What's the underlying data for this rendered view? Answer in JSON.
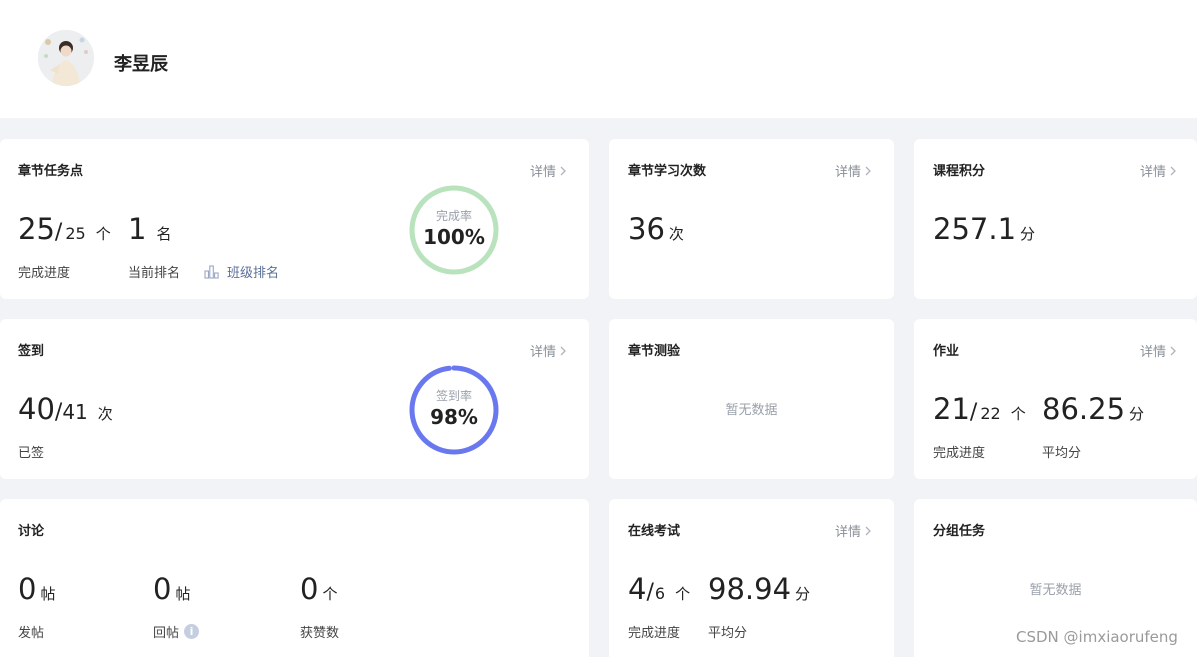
{
  "user": {
    "name": "李昱辰"
  },
  "common": {
    "detail": "详情"
  },
  "chapter_tasks": {
    "title": "章节任务点",
    "done": "25",
    "total": "25",
    "slash": "/",
    "unit": "个",
    "rank": "1",
    "rank_unit": "名",
    "progress_label": "完成进度",
    "rank_label": "当前排名",
    "class_rank_link": "班级排名",
    "ring_label": "完成率",
    "ring_value": "100%",
    "ring_fraction": 1.0,
    "ring_color": "#b8e3bd"
  },
  "chapter_study": {
    "title": "章节学习次数",
    "value": "36",
    "unit": "次"
  },
  "course_points": {
    "title": "课程积分",
    "value": "257.1",
    "unit": "分"
  },
  "signin": {
    "title": "签到",
    "done": "40",
    "total": "41",
    "slash": "/",
    "unit": "次",
    "label": "已签",
    "ring_label": "签到率",
    "ring_value": "98%",
    "ring_fraction": 0.98,
    "ring_color": "#6a78f0",
    "ring_track": "#e3e6f5"
  },
  "chapter_test": {
    "title": "章节测验",
    "empty": "暂无数据"
  },
  "homework": {
    "title": "作业",
    "done": "21",
    "total": "22",
    "slash": "/",
    "unit": "个",
    "avg": "86.25",
    "avg_unit": "分",
    "progress_label": "完成进度",
    "avg_label": "平均分"
  },
  "discussion": {
    "title": "讨论",
    "posts": "0",
    "posts_unit": "帖",
    "posts_label": "发帖",
    "replies": "0",
    "replies_unit": "帖",
    "replies_label": "回帖",
    "likes": "0",
    "likes_unit": "个",
    "likes_label": "获赞数",
    "info_icon": "i"
  },
  "online_exam": {
    "title": "在线考试",
    "done": "4",
    "total": "6",
    "slash": "/",
    "unit": "个",
    "avg": "98.94",
    "avg_unit": "分",
    "progress_label": "完成进度",
    "avg_label": "平均分"
  },
  "group_task": {
    "title": "分组任务",
    "empty": "暂无数据"
  },
  "watermark": "CSDN @imxiaorufeng"
}
